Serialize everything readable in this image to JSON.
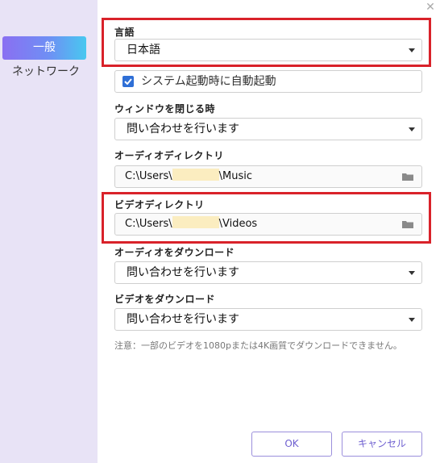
{
  "sidebar": {
    "items": [
      {
        "label": "一般",
        "active": true
      },
      {
        "label": "ネットワーク",
        "active": false
      }
    ]
  },
  "window": {
    "close_icon": "close-icon"
  },
  "settings": {
    "language": {
      "label": "言語",
      "value": "日本語"
    },
    "startup": {
      "label": "システム起動時に自動起動",
      "checked": true
    },
    "close_window": {
      "label": "ウィンドウを閉じる時",
      "value": "問い合わせを行います"
    },
    "audio_dir": {
      "label": "オーディオディレクトリ",
      "prefix": "C:\\Users\\",
      "suffix": "\\Music"
    },
    "video_dir": {
      "label": "ビデオディレクトリ",
      "prefix": "C:\\Users\\",
      "suffix": "\\Videos"
    },
    "audio_download": {
      "label": "オーディオをダウンロード",
      "value": "問い合わせを行います"
    },
    "video_download": {
      "label": "ビデオをダウンロード",
      "value": "問い合わせを行います"
    },
    "note": "注意：一部のビデオを1080pまたは4K画質でダウンロードできません。"
  },
  "footer": {
    "ok_label": "OK",
    "cancel_label": "キャンセル"
  },
  "colors": {
    "accent": "#6e5fd0",
    "highlight": "#d9222a",
    "sidebar_bg": "#e8e3f6"
  }
}
